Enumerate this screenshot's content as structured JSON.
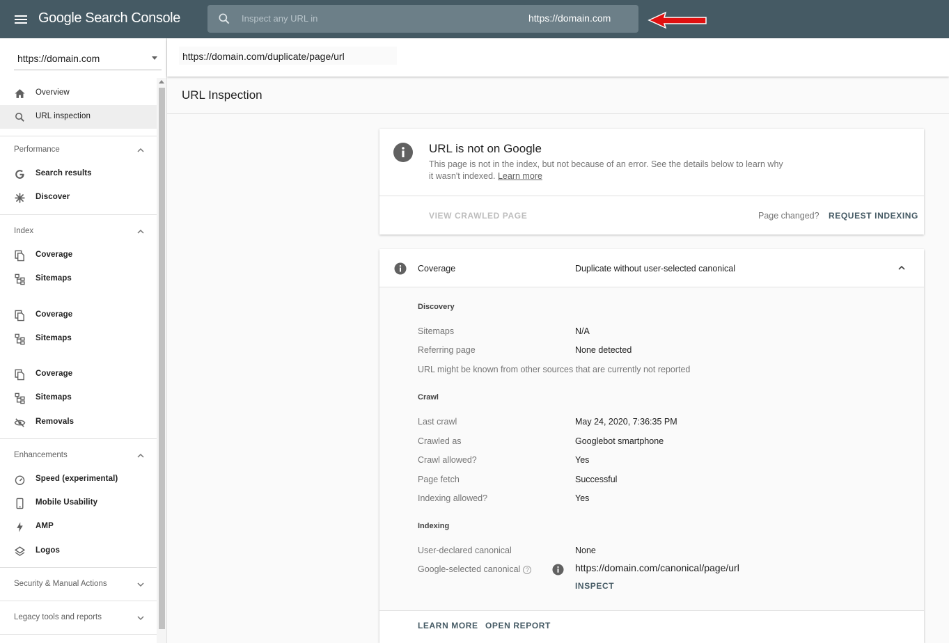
{
  "header": {
    "menu_icon": "menu-icon",
    "logo_text": "Google Search Console",
    "search_prefix": "Inspect any URL in",
    "search_value": "https://domain.com",
    "annotation": "red-arrow-icon",
    "bar_color": "#455a64"
  },
  "property": {
    "value": "https://domain.com"
  },
  "url_bar": {
    "value": "https://domain.com/duplicate/page/url"
  },
  "sidebar": {
    "items_top": [
      {
        "label": "Overview",
        "icon": "home-icon"
      },
      {
        "label": "URL inspection",
        "icon": "search-icon",
        "active": true
      }
    ],
    "performance": {
      "title": "Performance",
      "items": [
        {
          "label": "Search results",
          "icon": "google-g-icon"
        },
        {
          "label": "Discover",
          "icon": "asterisk-icon"
        }
      ]
    },
    "index": {
      "title": "Index",
      "items": [
        {
          "label": "Coverage",
          "icon": "file-copy-icon"
        },
        {
          "label": "Sitemaps",
          "icon": "sitemap-icon"
        },
        {
          "label": "Coverage",
          "icon": "file-copy-icon"
        },
        {
          "label": "Sitemaps",
          "icon": "sitemap-icon"
        },
        {
          "label": "Coverage",
          "icon": "file-copy-icon"
        },
        {
          "label": "Sitemaps",
          "icon": "sitemap-icon"
        },
        {
          "label": "Removals",
          "icon": "eye-off-icon"
        }
      ]
    },
    "enhancements": {
      "title": "Enhancements",
      "items": [
        {
          "label": "Speed (experimental)",
          "icon": "speedometer-icon"
        },
        {
          "label": "Mobile Usability",
          "icon": "phone-icon"
        },
        {
          "label": "AMP",
          "icon": "bolt-icon"
        },
        {
          "label": "Logos",
          "icon": "layers-icon"
        }
      ]
    },
    "security": {
      "title": "Security & Manual Actions"
    },
    "legacy": {
      "title": "Legacy tools and reports"
    }
  },
  "main": {
    "page_title": "URL Inspection",
    "status_card": {
      "heading": "URL is not on Google",
      "description": "This page is not in the index, but not because of an error. See the details below to learn why it wasn't indexed.",
      "learn_more_link": "Learn more",
      "view_crawled": "VIEW CRAWLED PAGE",
      "page_changed": "Page changed?",
      "request_indexing": "REQUEST INDEXING"
    },
    "coverage_card": {
      "label": "Coverage",
      "value": "Duplicate without user-selected canonical",
      "discovery": {
        "title": "Discovery",
        "rows": [
          {
            "k": "Sitemaps",
            "v": "N/A"
          },
          {
            "k": "Referring page",
            "v": "None detected"
          }
        ],
        "note": "URL might be known from other sources that are currently not reported"
      },
      "crawl": {
        "title": "Crawl",
        "rows": [
          {
            "k": "Last crawl",
            "v": "May 24, 2020, 7:36:35 PM"
          },
          {
            "k": "Crawled as",
            "v": "Googlebot smartphone"
          },
          {
            "k": "Crawl allowed?",
            "v": "Yes"
          },
          {
            "k": "Page fetch",
            "v": "Successful"
          },
          {
            "k": "Indexing allowed?",
            "v": "Yes"
          }
        ]
      },
      "indexing": {
        "title": "Indexing",
        "rows": [
          {
            "k": "User-declared canonical",
            "v": "None"
          },
          {
            "k": "Google-selected canonical",
            "v": "https://domain.com/canonical/page/url"
          }
        ],
        "help_glyph": "?",
        "inspect": "INSPECT"
      },
      "learn_more": "LEARN MORE",
      "open_report": "OPEN REPORT"
    }
  }
}
